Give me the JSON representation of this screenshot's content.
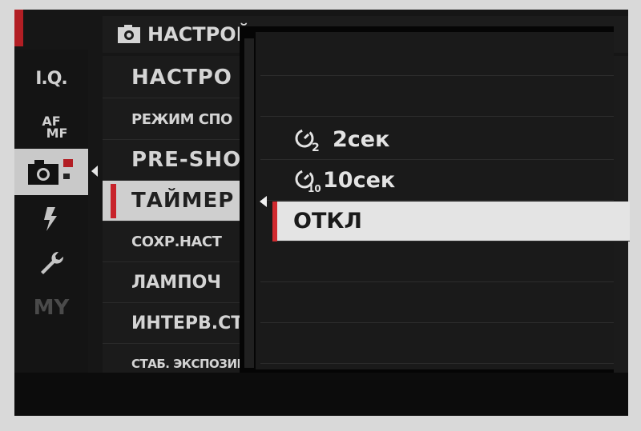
{
  "header": {
    "title": "НАСТРОЙКА СЪЕМКИ"
  },
  "sidebar": {
    "items": [
      {
        "label": "I.Q.",
        "icon": "iq-icon"
      },
      {
        "label_top": "AF",
        "label_bottom": "MF",
        "icon": "af-mf-icon"
      },
      {
        "icon": "camera-icon",
        "selected": true
      },
      {
        "icon": "flash-icon"
      },
      {
        "icon": "wrench-icon"
      },
      {
        "label": "MY",
        "icon": "my-menu-icon"
      }
    ]
  },
  "menu": {
    "items": [
      {
        "label": "НАСТРО"
      },
      {
        "label": "РЕЖИМ СПО"
      },
      {
        "label": "PRE-SHO"
      },
      {
        "label": "ТАЙМЕР",
        "selected": true
      },
      {
        "label": "СОХР.НАСТ"
      },
      {
        "label": "ЛАМПОЧ"
      },
      {
        "label": "ИНТЕРВ.СТ"
      },
      {
        "label": "СТАБ. ЭКСПОЗИЦ"
      }
    ]
  },
  "popup": {
    "options": [
      {
        "label": "",
        "icon": ""
      },
      {
        "label": "",
        "icon": ""
      },
      {
        "label": "2сек",
        "icon": "timer-2s-icon"
      },
      {
        "label": "10сек",
        "icon": "timer-10s-icon"
      },
      {
        "label": "ОТКЛ",
        "icon": "",
        "selected": true
      },
      {
        "label": "",
        "icon": ""
      },
      {
        "label": "",
        "icon": ""
      },
      {
        "label": "",
        "icon": ""
      }
    ]
  },
  "colors": {
    "accent": "#c8232b",
    "highlight": "#e4e4e4",
    "background": "#1b1b1b"
  }
}
